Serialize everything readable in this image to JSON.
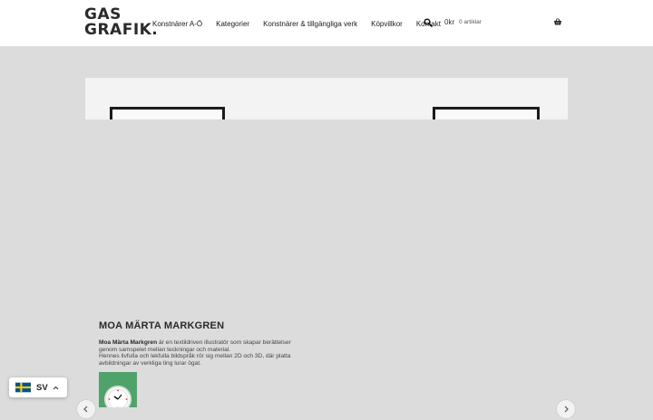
{
  "brand": {
    "logo_line1": "GAS",
    "logo_line2": "GRAFIK."
  },
  "nav": {
    "items": [
      {
        "label": "Konstnärer A-Ö"
      },
      {
        "label": "Kategorier"
      },
      {
        "label": "Konstnärer & tillgängliga verk"
      },
      {
        "label": "Köpvillkor"
      },
      {
        "label": "Kontakt"
      }
    ]
  },
  "header_icons": {
    "search": "search-icon",
    "basket": "basket-icon"
  },
  "cart": {
    "amount": "0kr",
    "count": "0 artiklar"
  },
  "hero": {
    "image": "framed-artwork-photos"
  },
  "artist": {
    "title": "MOA MÄRTA MARKGREN",
    "name_bold": "Moa Märta Markgren",
    "desc_1": " är en textildriven illustratör som skapar berättelser genom samspelet mellan teckningar och material.",
    "desc_2": "Hennes livfulla och lekfulla bildspråk rör sig mellan 2D och 3D, där platta avbildningar av verkliga ting lurar ögat."
  },
  "slider": {
    "prev_icon": "chevron-left-icon",
    "next_icon": "chevron-right-icon"
  },
  "language": {
    "code": "SV",
    "flag": "sweden-flag-icon"
  },
  "colors": {
    "header_bg": "#ffffff",
    "page_bg": "#dcdcdc",
    "thumb_bg": "#4fa36a",
    "flag_blue": "#005293",
    "flag_yellow": "#fecb00"
  }
}
